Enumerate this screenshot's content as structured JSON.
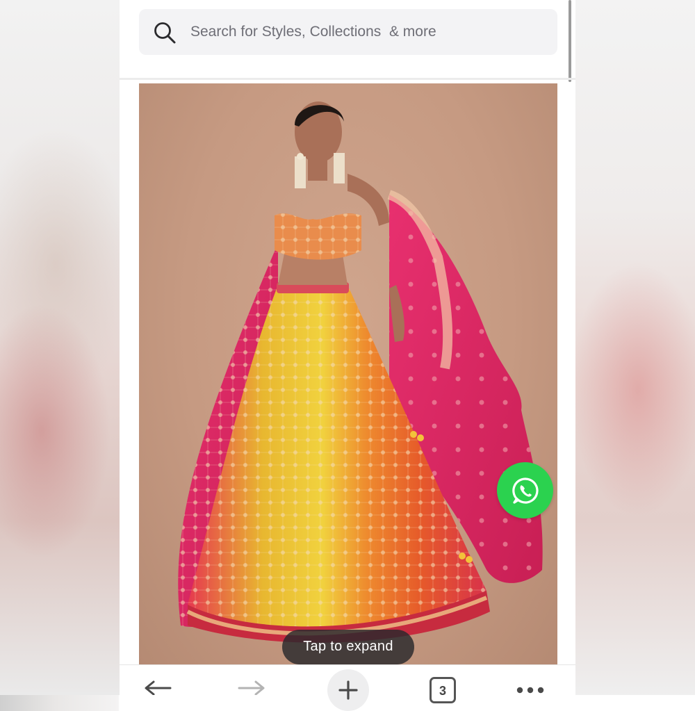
{
  "search": {
    "placeholder": "Search for Styles, Collections  & more"
  },
  "product": {
    "image_alt": "Model wearing pink, yellow and orange embroidered lehenga with pink dupatta",
    "expand_label": "Tap to expand"
  },
  "contact": {
    "whatsapp_icon": "whatsapp-icon",
    "color": "#2bd24f"
  },
  "browser_toolbar": {
    "back_icon": "arrow-left-icon",
    "forward_icon": "arrow-right-icon",
    "new_tab_icon": "plus-icon",
    "tab_count": "3",
    "menu_icon": "more-dots-icon"
  }
}
